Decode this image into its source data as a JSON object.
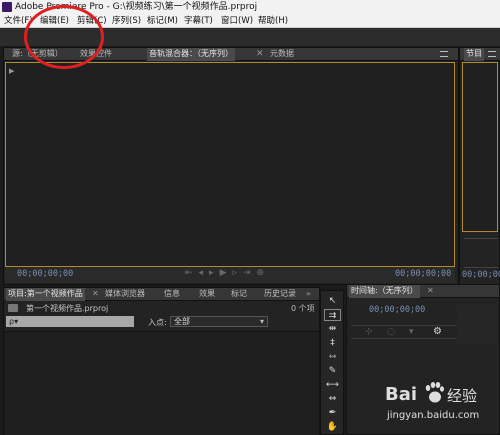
{
  "window": {
    "title": "Adobe Premiere Pro - G:\\视频练习\\第一个视频作品.prproj"
  },
  "menu": [
    {
      "label": "文件(F)"
    },
    {
      "label": "编辑(E)"
    },
    {
      "label": "剪辑(C)"
    },
    {
      "label": "序列(S)"
    },
    {
      "label": "标记(M)"
    },
    {
      "label": "字幕(T)"
    },
    {
      "label": "窗口(W)"
    },
    {
      "label": "帮助(H)"
    }
  ],
  "source_panel": {
    "tabs": [
      "源:（无剪辑）",
      "效果控件",
      "音轨混合器：（无序列）",
      "元数据"
    ],
    "timecode_left": "00;00;00;00",
    "timecode_right": "00;00;00;00"
  },
  "program_panel": {
    "tab": "节目",
    "timecode": "00;00;00;00"
  },
  "project_panel": {
    "tabs": [
      "项目:第一个视频作品",
      "媒体浏览器",
      "信息",
      "效果",
      "标记",
      "历史记录"
    ],
    "project_file": "第一个视频作品.prproj",
    "item_count": "0 个项",
    "search_placeholder": "ρ▾",
    "in_point_label": "入点:",
    "in_point_value": "全部"
  },
  "timeline_panel": {
    "tab": "时间轴:（无序列）",
    "timecode": "00;00;00;00"
  },
  "watermark": {
    "brand": "Bai",
    "brand2": "经验",
    "url": "jingyan.baidu.com"
  },
  "colors": {
    "annotation": "#e02020",
    "monitor_border": "#b28a2a",
    "timecode": "#7a8fb0"
  }
}
